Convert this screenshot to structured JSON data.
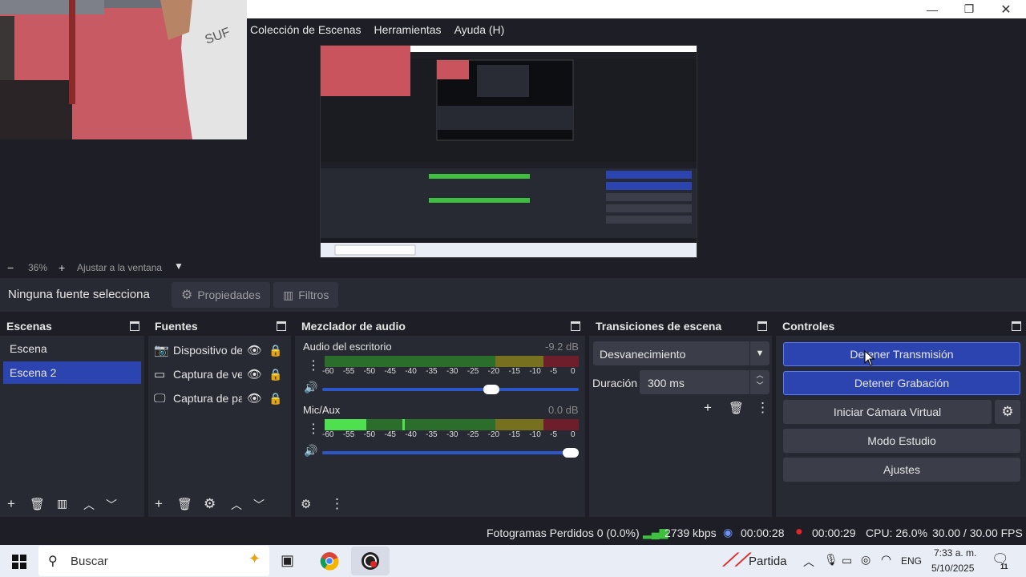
{
  "menu": {
    "items": [
      "Colección de Escenas",
      "Herramientas",
      "Ayuda (H)"
    ]
  },
  "window_controls": {
    "minimize": "—",
    "restore": "❐",
    "close": "✕"
  },
  "zoom": {
    "minus": "−",
    "level": "36%",
    "plus": "+",
    "fit": "Ajustar a la ventana"
  },
  "source_bar": {
    "status": "Ninguna fuente selecciona",
    "properties": "Propiedades",
    "filters": "Filtros"
  },
  "scenes": {
    "title": "Escenas",
    "items": [
      "Escena",
      "Escena 2"
    ],
    "selected": "Escena 2"
  },
  "sources": {
    "title": "Fuentes",
    "items": [
      "Dispositivo de",
      "Captura de ver",
      "Captura de pa"
    ]
  },
  "mixer": {
    "title": "Mezclador de audio",
    "tracks": [
      {
        "name": "Audio del escritorio",
        "db": "-9.2 dB",
        "volume_level": 0.66
      },
      {
        "name": "Mic/Aux",
        "db": "0.0 dB",
        "volume_level": 0.97
      }
    ],
    "ticks": [
      "-60",
      "-55",
      "-50",
      "-45",
      "-40",
      "-35",
      "-30",
      "-25",
      "-20",
      "-15",
      "-10",
      "-5",
      "0"
    ]
  },
  "transitions": {
    "title": "Transiciones de escena",
    "selected": "Desvanecimiento",
    "duration_label": "Duración",
    "duration_value": "300 ms"
  },
  "controls": {
    "title": "Controles",
    "stop_stream": "Detener Transmisión",
    "stop_recording": "Detener Grabación",
    "virtual_cam": "Iniciar Cámara Virtual",
    "studio_mode": "Modo Estudio",
    "settings": "Ajustes"
  },
  "status": {
    "dropped_frames": "Fotogramas Perdidos 0 (0.0%)",
    "bitrate": "2739 kbps",
    "stream_time": "00:00:28",
    "rec_time": "00:00:29",
    "cpu": "CPU: 26.0%",
    "fps": "30.00 / 30.00 FPS"
  },
  "taskbar": {
    "search_placeholder": "Buscar",
    "pinned": "Partida",
    "language": "ENG",
    "time": "7:33 a. m.",
    "date": "5/10/2025",
    "notification_count": "11"
  },
  "colors": {
    "accent": "#2c44b0",
    "panel": "#272a33",
    "background": "#1e1f26",
    "record": "#e02626"
  }
}
